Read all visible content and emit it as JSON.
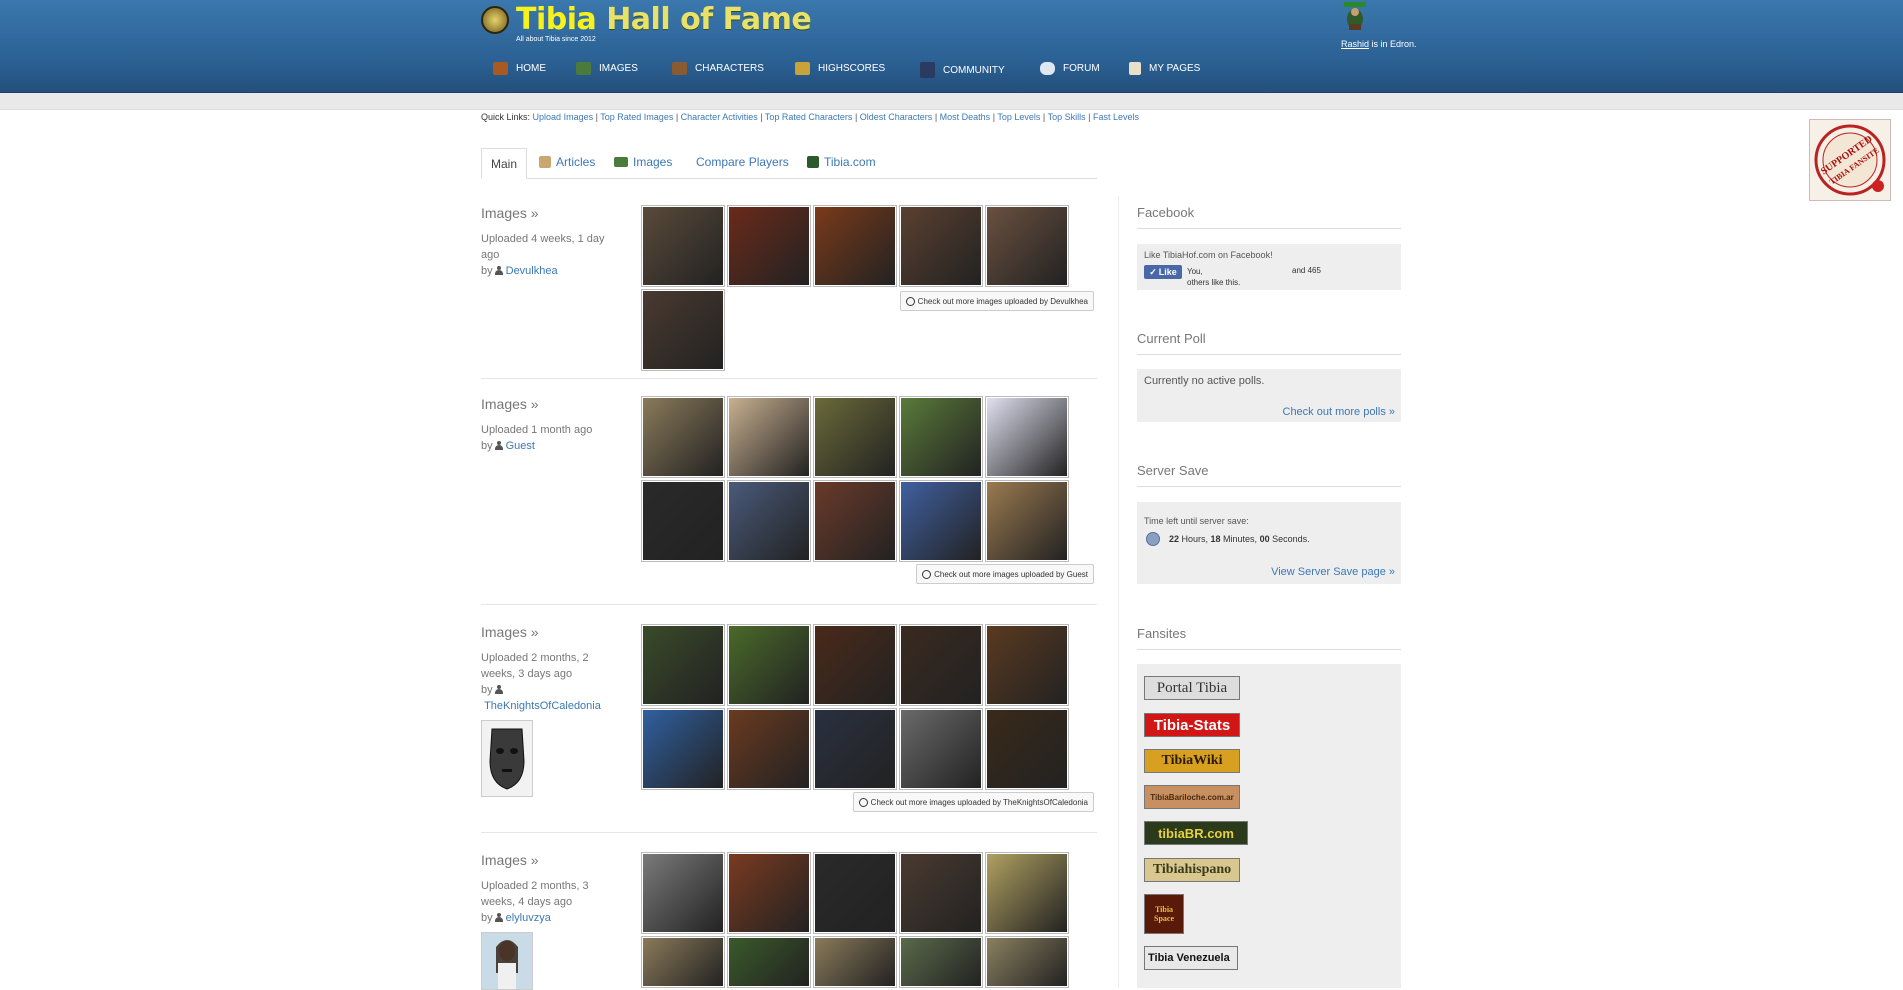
{
  "header": {
    "title_part1": "Tibia",
    "title_part2": "Hall of Fame",
    "tagline": "All about Tibia since 2012",
    "npc_name": "Rashid",
    "npc_text": " is in Edron.",
    "nav": [
      {
        "label": "HOME",
        "icon": "home-icon",
        "color": "#a85a20"
      },
      {
        "label": "IMAGES",
        "icon": "images-icon",
        "color": "#4b7b3a"
      },
      {
        "label": "CHARACTERS",
        "icon": "characters-icon",
        "color": "#8a5a30"
      },
      {
        "label": "HIGHSCORES",
        "icon": "highscores-icon",
        "color": "#c9a23a"
      },
      {
        "label": "COMMUNITY",
        "icon": "community-icon",
        "color": "#2a3a60"
      },
      {
        "label": "FORUM",
        "icon": "forum-icon",
        "color": "#dfe8f0"
      },
      {
        "label": "MY PAGES",
        "icon": "my-pages-icon",
        "color": "#e8e0c8"
      }
    ]
  },
  "quick_links": {
    "label": "Quick Links:",
    "links": [
      "Upload Images",
      "Top Rated Images",
      "Character Activities",
      "Top Rated Characters",
      "Oldest Characters",
      "Most Deaths",
      "Top Levels",
      "Top Skills",
      "Fast Levels"
    ]
  },
  "badge": {
    "line1": "SUPPORTED",
    "line2": "TIBIA FANSITE"
  },
  "tabs": [
    {
      "label": "Main",
      "icon": ""
    },
    {
      "label": "Articles",
      "icon": "articles-icon"
    },
    {
      "label": "Images",
      "icon": "images-icon"
    },
    {
      "label": "Compare Players",
      "icon": ""
    },
    {
      "label": "Tibia.com",
      "icon": "tibia-com-icon"
    }
  ],
  "entries": [
    {
      "title": "Images »",
      "uploaded": "Uploaded 4 weeks, 1 day ago",
      "by": "by",
      "user": "Devulkhea",
      "button": "Check out more images uploaded by Devulkhea",
      "thumb_colors": [
        "#5a4a3a",
        "#6a2a1a",
        "#7a3a1a",
        "#5a4030",
        "#6a5040",
        "#4a3a30"
      ]
    },
    {
      "title": "Images »",
      "uploaded": "Uploaded 1 month ago",
      "by": "by",
      "user": "Guest",
      "button": "Check out more images uploaded by Guest",
      "thumb_colors": [
        "#8a7a5a",
        "#c8b090",
        "#6a6a3a",
        "#5a7a3a",
        "#e0e0f0",
        "#2a2a2a",
        "#4a5a7a",
        "#6a3a2a",
        "#4060a0",
        "#9a7a50"
      ]
    },
    {
      "title": "Images »",
      "uploaded": "Uploaded 2 months, 2 weeks, 3 days ago",
      "by": "by",
      "user": "TheKnightsOfCaledonia",
      "button": "Check out more images uploaded by TheKnightsOfCaledonia",
      "thumb_colors": [
        "#3a4a2a",
        "#4a6a2a",
        "#4a2a1a",
        "#3a2a20",
        "#5a3a20",
        "#3060a0",
        "#6a3a20",
        "#2a3040",
        "#6a6a6a",
        "#3a2a1a"
      ]
    },
    {
      "title": "Images »",
      "uploaded": "Uploaded 2 months, 3 weeks, 4 days ago",
      "by": "by",
      "user": "elyluvzya",
      "thumb_colors": [
        "#7a7a7a",
        "#7a3a20",
        "#2a2a2a",
        "#4a3a30",
        "#b0a060",
        "#8a7a5a",
        "#3a5a2a",
        "#8a7a5a",
        "#5a6a4a",
        "#8a8060"
      ]
    }
  ],
  "sidebar": {
    "facebook": {
      "heading": "Facebook",
      "line1": "Like TibiaHof.com on Facebook!",
      "like": "Like",
      "you": "You,",
      "and": "and 465",
      "others": "others like this."
    },
    "poll": {
      "heading": "Current Poll",
      "text": "Currently no active polls.",
      "link": "Check out more polls »"
    },
    "server_save": {
      "heading": "Server Save",
      "label": "Time left until server save:",
      "hours": "22",
      "hours_unit": " Hours, ",
      "minutes": "18",
      "minutes_unit": " Minutes, ",
      "seconds": "00",
      "seconds_unit": " Seconds.",
      "link": "View Server Save page »"
    },
    "fansites": {
      "heading": "Fansites",
      "items": [
        "Portal Tibia",
        "Tibia-Stats",
        "TibiaWiki",
        "TibiaBariloche.com.ar",
        "tibiaBR.com",
        "Tibiahispano",
        "Tibia Space",
        "Tibia Venezuela"
      ]
    }
  }
}
